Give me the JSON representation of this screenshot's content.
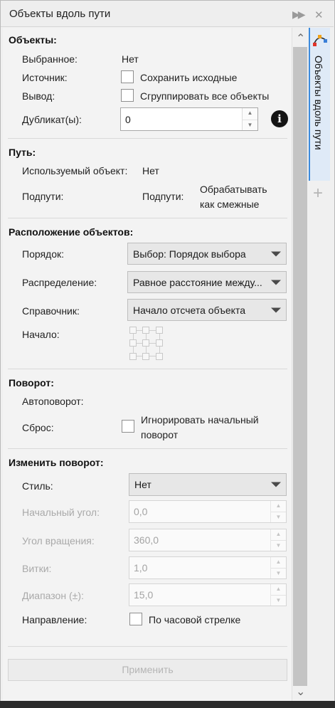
{
  "window": {
    "title": "Объекты вдоль пути",
    "tab_label": "Объекты вдоль пути"
  },
  "objects": {
    "heading": "Объекты:",
    "selected_label": "Выбранное:",
    "selected_value": "Нет",
    "source_label": "Источник:",
    "source_option": "Сохранить исходные",
    "output_label": "Вывод:",
    "output_option": "Сгруппировать все объекты",
    "duplicates_label": "Дубликат(ы):",
    "duplicates_value": "0"
  },
  "path": {
    "heading": "Путь:",
    "used_object_label": "Используемый объект:",
    "used_object_value": "Нет",
    "subpaths_label": "Подпути:",
    "subpaths_label2": "Подпути:",
    "subpaths_value_line1": "Обрабатывать",
    "subpaths_value_line2": "как смежные"
  },
  "layout": {
    "heading": "Расположение объектов:",
    "order_label": "Порядок:",
    "order_value": "Выбор: Порядок выбора",
    "distribution_label": "Распределение:",
    "distribution_value": "Равное расстояние между...",
    "reference_label": "Справочник:",
    "reference_value": "Начало отсчета объекта",
    "origin_label": "Начало:"
  },
  "rotation": {
    "heading": "Поворот:",
    "auto_label": "Автоповорот:",
    "reset_label": "Сброс:",
    "reset_option_line1": "Игнорировать начальный",
    "reset_option_line2": "поворот"
  },
  "change_rotation": {
    "heading": "Изменить поворот:",
    "style_label": "Стиль:",
    "style_value": "Нет",
    "start_angle_label": "Начальный угол:",
    "start_angle_value": "0,0",
    "rotation_angle_label": "Угол вращения:",
    "rotation_angle_value": "360,0",
    "turns_label": "Витки:",
    "turns_value": "1,0",
    "range_label": "Диапазон (±):",
    "range_value": "15,0",
    "direction_label": "Направление:",
    "direction_option": "По часовой стрелке"
  },
  "apply_label": "Применить",
  "icons": {
    "info": "i",
    "plus": "+",
    "scroll_up": "⌃",
    "scroll_down": "⌄"
  },
  "colors": {
    "accent": "#3d8bdc",
    "tab_bg": "#dfeaf7"
  }
}
